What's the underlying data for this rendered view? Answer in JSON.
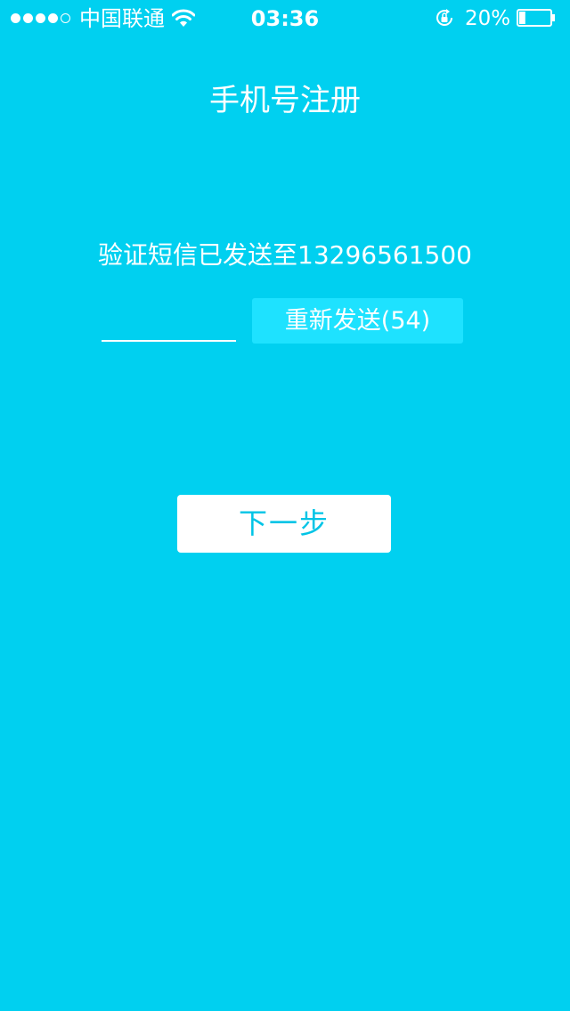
{
  "status_bar": {
    "signal_dots_filled": 4,
    "signal_dots_total": 5,
    "carrier": "中国联通",
    "time": "03:36",
    "battery_percent": "20%",
    "battery_level": 0.2,
    "wifi_icon": "wifi-icon",
    "lock_icon": "orientation-lock-icon"
  },
  "page": {
    "title": "手机号注册",
    "sent_message": "验证短信已发送至13296561500",
    "code_input_value": "",
    "resend_label": "重新发送(54)",
    "next_label": "下一步"
  },
  "colors": {
    "background": "#00d0f0",
    "resend_button_bg": "#1ee2ff",
    "next_button_bg": "#ffffff",
    "next_button_text": "#00c4e6"
  }
}
